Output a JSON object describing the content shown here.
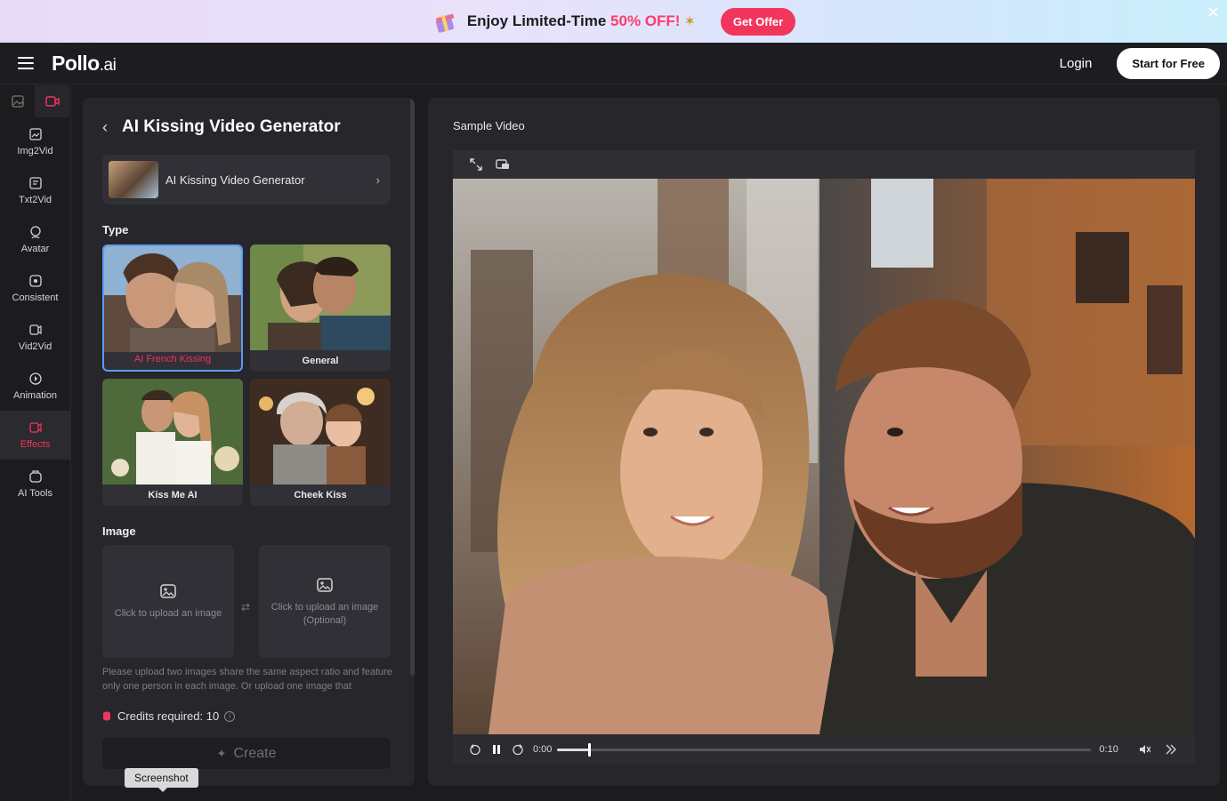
{
  "banner": {
    "text_prefix": "Enjoy Limited-Time ",
    "text_accent": "50% OFF!",
    "offer_button": "Get Offer",
    "close": "✕"
  },
  "navbar": {
    "logo_main": "Pollo",
    "logo_suffix": ".ai",
    "login": "Login",
    "start_button": "Start for Free"
  },
  "sidebar": {
    "items": [
      {
        "label": "Img2Vid"
      },
      {
        "label": "Txt2Vid"
      },
      {
        "label": "Avatar"
      },
      {
        "label": "Consistent"
      },
      {
        "label": "Vid2Vid"
      },
      {
        "label": "Animation"
      },
      {
        "label": "Effects",
        "active": true
      },
      {
        "label": "AI Tools"
      }
    ]
  },
  "panel": {
    "title": "AI Kissing Video Generator",
    "generator_card": "AI Kissing Video Generator",
    "type_label": "Type",
    "types": [
      {
        "label": "AI French Kissing",
        "selected": true
      },
      {
        "label": "General"
      },
      {
        "label": "Kiss Me AI"
      },
      {
        "label": "Cheek Kiss"
      }
    ],
    "image_label": "Image",
    "upload_primary": "Click to upload an image",
    "upload_optional_line1": "Click to upload an image",
    "upload_optional_line2": "(Optional)",
    "hint": "Please upload two images share the same aspect ratio and feature only one person in each image. Or upload one image that",
    "credits_label": "Credits required: 10",
    "create_button": "Create",
    "tooltip": "Screenshot"
  },
  "video": {
    "title": "Sample Video",
    "current_time": "0:00",
    "duration": "0:10",
    "progress_fraction": 0.06
  },
  "colors": {
    "accent": "#f2355d",
    "selected_border": "#5a9cf5"
  }
}
